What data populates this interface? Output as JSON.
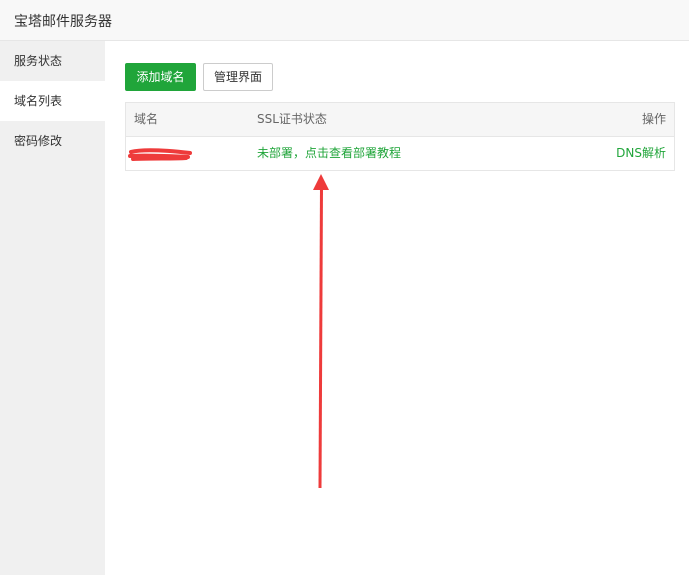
{
  "window": {
    "title": "宝塔邮件服务器"
  },
  "sidebar": {
    "items": [
      {
        "label": "服务状态",
        "active": false
      },
      {
        "label": "域名列表",
        "active": true
      },
      {
        "label": "密码修改",
        "active": false
      }
    ]
  },
  "toolbar": {
    "add_domain_label": "添加域名",
    "manage_ui_label": "管理界面"
  },
  "table": {
    "headers": {
      "domain": "域名",
      "ssl": "SSL证书状态",
      "action": "操作"
    },
    "rows": [
      {
        "domain": "",
        "ssl_status": "未部署，点击查看部署教程",
        "action": "DNS解析"
      }
    ]
  },
  "colors": {
    "accent": "#20a53a",
    "annotation": "#ee3b3b"
  }
}
